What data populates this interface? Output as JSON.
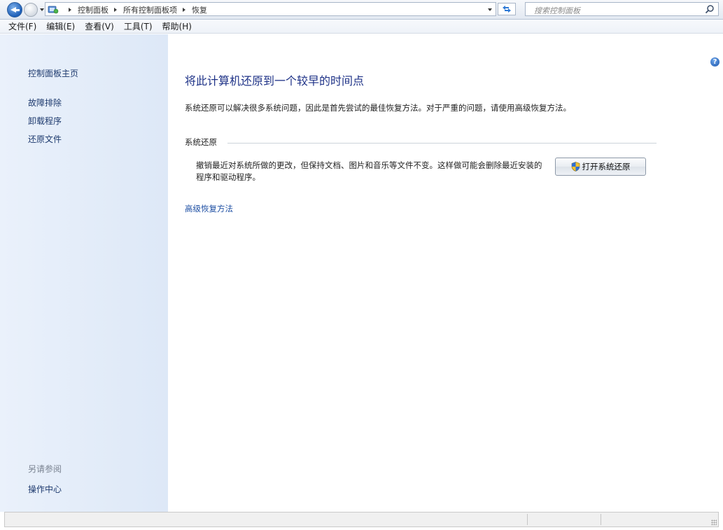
{
  "address_bar": {
    "breadcrumbs": [
      "控制面板",
      "所有控制面板项",
      "恢复"
    ],
    "search_placeholder": "搜索控制面板"
  },
  "menu": {
    "items": [
      "文件(F)",
      "编辑(E)",
      "查看(V)",
      "工具(T)",
      "帮助(H)"
    ]
  },
  "left_pane": {
    "home": "控制面板主页",
    "links": [
      "故障排除",
      "卸载程序",
      "还原文件"
    ],
    "see_also_heading": "另请参阅",
    "see_also_links": [
      "操作中心"
    ]
  },
  "main": {
    "title": "将此计算机还原到一个较早的时间点",
    "description": "系统还原可以解决很多系统问题，因此是首先尝试的最佳恢复方法。对于严重的问题，请使用高级恢复方法。",
    "section": {
      "title": "系统还原",
      "description": "撤销最近对系统所做的更改，但保持文档、图片和音乐等文件不变。这样做可能会删除最近安装的程序和驱动程序。",
      "button_label": "打开系统还原"
    },
    "advanced_link": "高级恢复方法",
    "help_symbol": "?"
  }
}
